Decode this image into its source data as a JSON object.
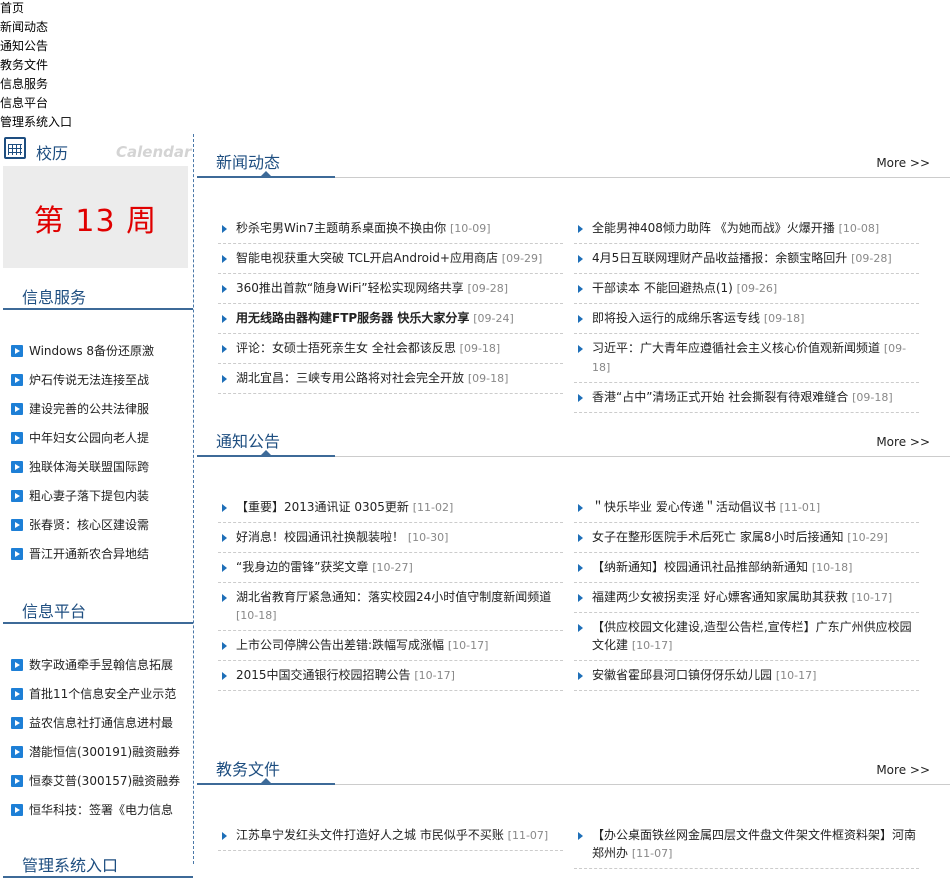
{
  "topnav": [
    "首页",
    "新闻动态",
    "通知公告",
    "教务文件",
    "信息服务",
    "信息平台",
    "管理系统入口"
  ],
  "calendar": {
    "title": "校历",
    "en": "Calendar",
    "week": "第 13 周"
  },
  "side": {
    "info_service": {
      "title": "信息服务",
      "items": [
        "Windows 8备份还原激",
        "炉石传说无法连接至战",
        "建设完善的公共法律服",
        "中年妇女公园向老人提",
        "独联体海关联盟国际跨",
        "粗心妻子落下提包内装",
        "张春贤：核心区建设需",
        "晋江开通新农合异地结"
      ]
    },
    "info_platform": {
      "title": "信息平台",
      "items": [
        "数字政通牵手昱翰信息拓展",
        "首批11个信息安全产业示范",
        "益农信息社打通信息进村最",
        "潜能恒信(300191)融资融券",
        "恒泰艾普(300157)融资融券",
        "恒华科技：签署《电力信息"
      ]
    },
    "mgmt": {
      "title": "管理系统入口"
    }
  },
  "main": {
    "more": "More >>",
    "news": {
      "title": "新闻动态",
      "left": [
        {
          "t": "秒杀宅男Win7主题萌系桌面换不换由你",
          "d": "[10-09]"
        },
        {
          "t": "智能电视获重大突破 TCL开启Android+应用商店",
          "d": "[09-29]"
        },
        {
          "t": "360推出首款“随身WiFi”轻松实现网络共享",
          "d": "[09-28]"
        },
        {
          "t": "用无线路由器构建FTP服务器 快乐大家分享",
          "d": "[09-24]"
        },
        {
          "t": "评论：女硕士捂死亲生女 全社会都该反思",
          "d": "[09-18]"
        },
        {
          "t": "湖北宜昌：三峡专用公路将对社会完全开放",
          "d": "[09-18]"
        }
      ],
      "right": [
        {
          "t": "全能男神408倾力助阵 《为她而战》火爆开播",
          "d": "[10-08]"
        },
        {
          "t": "4月5日互联网理财产品收益播报：余额宝略回升",
          "d": "[09-28]"
        },
        {
          "t": "干部读本 不能回避热点(1)",
          "d": "[09-26]"
        },
        {
          "t": "即将投入运行的成绵乐客运专线",
          "d": "[09-18]"
        },
        {
          "t": "习近平：广大青年应遵循社会主义核心价值观新闻频道",
          "d": "[09-18]"
        },
        {
          "t": "香港“占中”清场正式开始 社会撕裂有待艰难缝合",
          "d": "[09-18]"
        }
      ]
    },
    "notice": {
      "title": "通知公告",
      "left": [
        {
          "t": "【重要】2013通讯证 0305更新",
          "d": "[11-02]"
        },
        {
          "t": "好消息！校园通讯社换靓装啦！",
          "d": "[10-30]"
        },
        {
          "t": "“我身边的雷锋”获奖文章",
          "d": "[10-27]"
        },
        {
          "t": "湖北省教育厅紧急通知：落实校园24小时值守制度新闻频道",
          "d": "[10-18]"
        },
        {
          "t": "上市公司停牌公告出差错:跌幅写成涨幅",
          "d": "[10-17]"
        },
        {
          "t": "2015中国交通银行校园招聘公告",
          "d": "[10-17]"
        }
      ],
      "right": [
        {
          "t": "＂快乐毕业 爱心传递＂活动倡议书",
          "d": "[11-01]"
        },
        {
          "t": "女子在整形医院手术后死亡 家属8小时后接通知",
          "d": "[10-29]"
        },
        {
          "t": "【纳新通知】校园通讯社品推部纳新通知",
          "d": "[10-18]"
        },
        {
          "t": "福建两少女被拐卖淫 好心嫖客通知家属助其获救",
          "d": "[10-17]"
        },
        {
          "t": "【供应校园文化建设,造型公告栏,宣传栏】广东广州供应校园文化建",
          "d": "[10-17]"
        },
        {
          "t": "安徽省霍邱县河口镇伢伢乐幼儿园",
          "d": "[10-17]"
        }
      ]
    },
    "docs": {
      "title": "教务文件",
      "left": [
        {
          "t": "江苏阜宁发红头文件打造好人之城 市民似乎不买账",
          "d": "[11-07]"
        }
      ],
      "right": [
        {
          "t": "【办公桌面铁丝网金属四层文件盘文件架文件框资料架】河南郑州办",
          "d": "[11-07]"
        }
      ]
    }
  }
}
